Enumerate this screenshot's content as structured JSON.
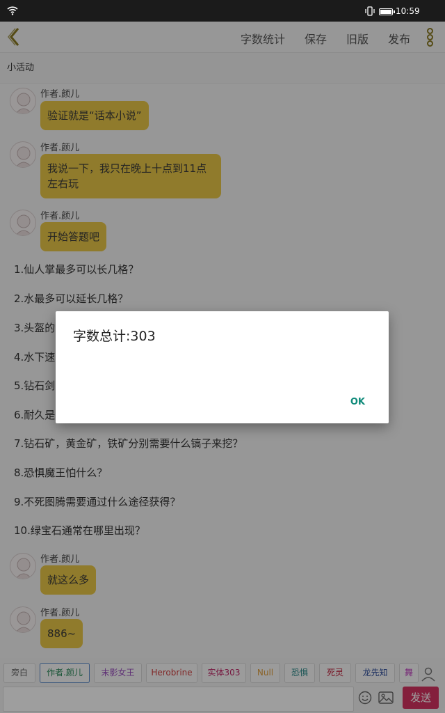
{
  "status": {
    "time": "10:59"
  },
  "toolbar": {
    "word_count": "字数统计",
    "save": "保存",
    "old_version": "旧版",
    "publish": "发布"
  },
  "page": {
    "subtitle": "小活动"
  },
  "messages": [
    {
      "author": "作者.颜儿",
      "text": "验证就是“话本小说”"
    },
    {
      "author": "作者.颜儿",
      "text": "我说一下，我只在晚上十点到11点左右玩"
    },
    {
      "author": "作者.颜儿",
      "text": "开始答题吧"
    },
    {
      "author": "作者.颜儿",
      "text": "就这么多"
    },
    {
      "author": "作者.颜儿",
      "text": "886~"
    }
  ],
  "questions": [
    "1.仙人掌最多可以长几格？",
    "2.水最多可以延长几格？",
    "3.头盔的",
    "4.水下速",
    "5.钻石剑",
    "6.耐久是",
    "7.钻石矿，黄金矿，铁矿分别需要什么镐子来挖？",
    "8.恐惧魔王怕什么？",
    "9.不死图腾需要通过什么途径获得？",
    "10.绿宝石通常在哪里出现？"
  ],
  "dialog": {
    "title": "字数总计:303",
    "ok": "OK"
  },
  "tags": [
    {
      "label": "旁白",
      "color": "#666666"
    },
    {
      "label": "作者.颜儿",
      "color": "#2a8a5a"
    },
    {
      "label": "末影女王",
      "color": "#9a4fbf"
    },
    {
      "label": "Herobrine",
      "color": "#d04040"
    },
    {
      "label": "实体303",
      "color": "#c02a6a"
    },
    {
      "label": "Null",
      "color": "#e0a040"
    },
    {
      "label": "恐惧",
      "color": "#2a8a8a"
    },
    {
      "label": "死灵",
      "color": "#c0203a"
    },
    {
      "label": "龙先知",
      "color": "#2a4a9a"
    },
    {
      "label": "舞",
      "color": "#c040c0"
    }
  ],
  "input": {
    "send": "发送"
  },
  "colors": {
    "bubble": "#e9c747",
    "accent": "#8a7a22",
    "send": "#d63362",
    "ok": "#0f8a7a"
  }
}
